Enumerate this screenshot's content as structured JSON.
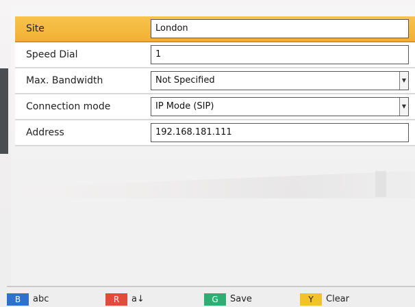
{
  "form": {
    "rows": [
      {
        "label": "Site",
        "value": "London",
        "type": "text"
      },
      {
        "label": "Speed Dial",
        "value": "1",
        "type": "text"
      },
      {
        "label": "Max. Bandwidth",
        "value": "Not Specified",
        "type": "select"
      },
      {
        "label": "Connection mode",
        "value": "IP Mode (SIP)",
        "type": "select"
      },
      {
        "label": "Address",
        "value": "192.168.181.111",
        "type": "text"
      }
    ]
  },
  "footer": {
    "hints": [
      {
        "key": "B",
        "label": "abc",
        "color": "#2f6fcf"
      },
      {
        "key": "R",
        "label": "a↓",
        "color": "#e24b3b"
      },
      {
        "key": "G",
        "label": "Save",
        "color": "#2fae73"
      },
      {
        "key": "Y",
        "label": "Clear",
        "color": "#f1c22a"
      }
    ]
  },
  "colors": {
    "selected_row": "#f1b134",
    "accent": "#f7c34b"
  },
  "icons": {
    "dropdown": "chevron-down-icon"
  }
}
